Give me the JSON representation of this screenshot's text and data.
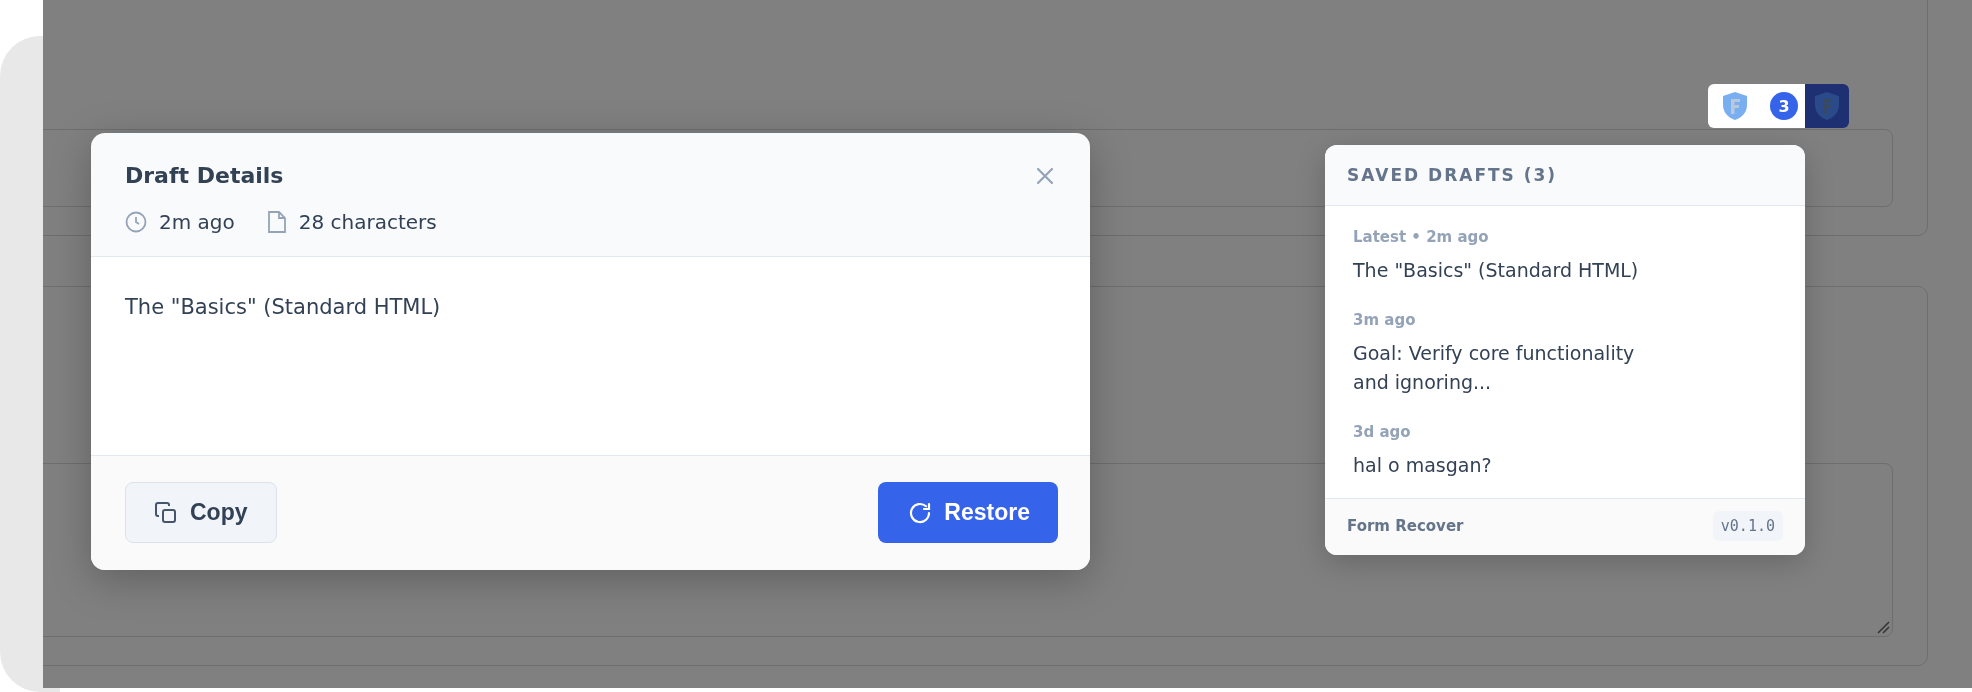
{
  "modal": {
    "title": "Draft Details",
    "time": "2m ago",
    "characters": "28 characters",
    "content": "The \"Basics\" (Standard HTML)",
    "buttons": [
      {
        "label": "Copy",
        "kind": "secondary"
      },
      {
        "label": "Restore",
        "kind": "primary"
      }
    ]
  },
  "launcher": {
    "count": "3"
  },
  "drafts_panel": {
    "title": "SAVED DRAFTS (3)",
    "drafts": [
      {
        "meta": "Latest • 2m ago",
        "text": "The \"Basics\" (Standard HTML)"
      },
      {
        "meta": "3m ago",
        "text": "Goal: Verify core functionality and ignoring..."
      },
      {
        "meta": "3d ago",
        "text": "hal o masgan?"
      }
    ],
    "footer": {
      "name": "Form Recover",
      "version": "v0.1.0"
    }
  }
}
